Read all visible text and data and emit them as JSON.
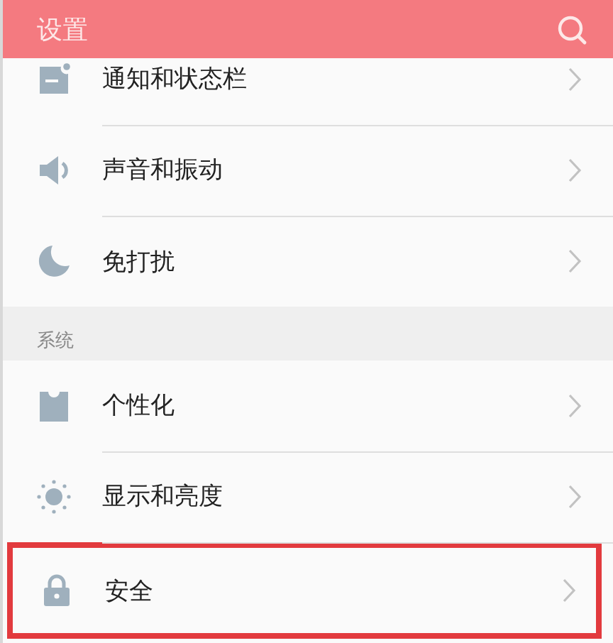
{
  "header": {
    "title": "设置"
  },
  "sections": [
    {
      "items": [
        {
          "label": "通知和状态栏",
          "highlighted": false
        },
        {
          "label": "声音和振动",
          "highlighted": false
        },
        {
          "label": "免打扰",
          "highlighted": false
        }
      ]
    },
    {
      "title": "系统",
      "items": [
        {
          "label": "个性化",
          "highlighted": false
        },
        {
          "label": "显示和亮度",
          "highlighted": false
        },
        {
          "label": "安全",
          "highlighted": true
        }
      ]
    }
  ]
}
